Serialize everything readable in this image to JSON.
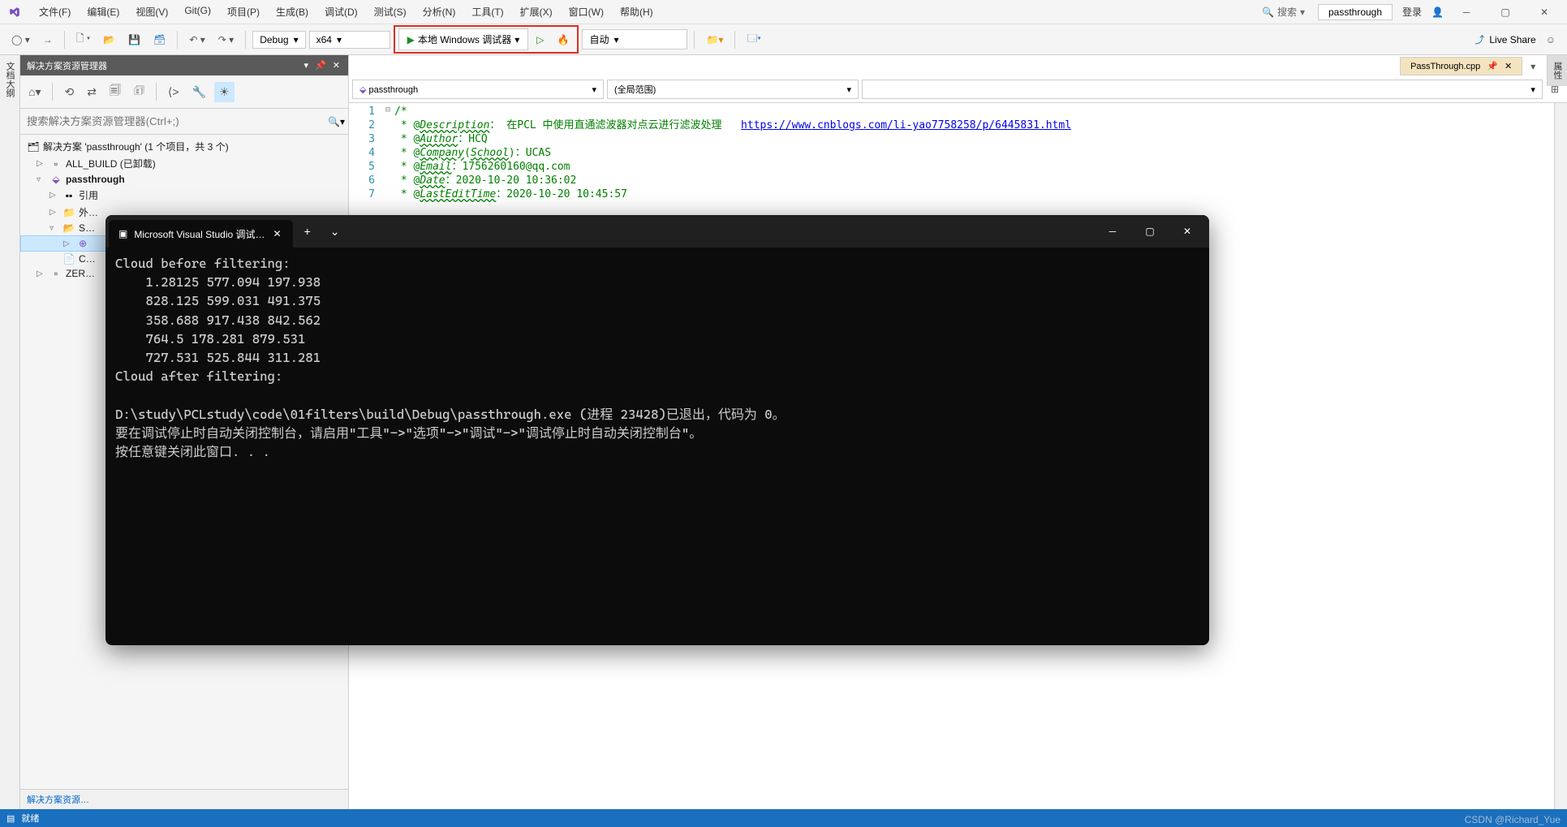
{
  "menu": {
    "file": "文件(F)",
    "edit": "编辑(E)",
    "view": "视图(V)",
    "git": "Git(G)",
    "project": "项目(P)",
    "build": "生成(B)",
    "debug": "调试(D)",
    "test": "测试(S)",
    "analyze": "分析(N)",
    "tools": "工具(T)",
    "extensions": "扩展(X)",
    "window": "窗口(W)",
    "help": "帮助(H)"
  },
  "title_right": {
    "search": "搜索",
    "solution_name": "passthrough",
    "login": "登录"
  },
  "toolbar": {
    "configuration": "Debug",
    "platform": "x64",
    "debugger": "本地 Windows 调试器",
    "target": "自动",
    "live_share": "Live Share"
  },
  "side_tab_left": "文档大纲",
  "side_tab_right": "属性",
  "solution_explorer": {
    "title": "解决方案资源管理器",
    "search_placeholder": "搜索解决方案资源管理器(Ctrl+;)",
    "root": "解决方案 'passthrough' (1 个项目，共 3 个)",
    "items": {
      "all_build": "ALL_BUILD (已卸载)",
      "passthrough": "passthrough",
      "references": "引用",
      "external": "外…",
      "source": "S…",
      "cmake": "C…",
      "zero": "ZER…"
    },
    "bottom_tab": "解决方案资源…"
  },
  "editor": {
    "tab_name": "PassThrough.cpp",
    "scope_project": "passthrough",
    "scope_global": "(全局范围)",
    "lines": {
      "1": "/*",
      "2_prefix": " * @",
      "2_tag": "Description",
      "2_colon": "：",
      "2_text": " 在PCL 中使用直通滤波器对点云进行滤波处理   ",
      "2_link": "https://www.cnblogs.com/li-yao7758258/p/6445831.html",
      "3_prefix": " * @",
      "3_tag": "Author",
      "3_rest": "：HCQ",
      "4_prefix": " * @",
      "4_tag": "Company",
      "4_paren": "(",
      "4_tag2": "School",
      "4_rest": ")：UCAS",
      "5_prefix": " * @",
      "5_tag": "Email",
      "5_rest": "：1756260160@qq.com",
      "6_prefix": " * @",
      "6_tag": "Date",
      "6_rest": "：2020-10-20 10:36:02",
      "7_prefix": " * @",
      "7_tag": "LastEditTime",
      "7_rest": "：2020-10-20 10:45:57"
    }
  },
  "console": {
    "tab_title": "Microsoft Visual Studio 调试…",
    "output": "Cloud before filtering:\n    1.28125 577.094 197.938\n    828.125 599.031 491.375\n    358.688 917.438 842.562\n    764.5 178.281 879.531\n    727.531 525.844 311.281\nCloud after filtering:\n\nD:\\study\\PCLstudy\\code\\01filters\\build\\Debug\\passthrough.exe (进程 23428)已退出，代码为 0。\n要在调试停止时自动关闭控制台，请启用\"工具\"->\"选项\"->\"调试\"->\"调试停止时自动关闭控制台\"。\n按任意键关闭此窗口. . ."
  },
  "status_bar": {
    "ready": "就绪"
  },
  "watermark": "CSDN @Richard_Yue"
}
